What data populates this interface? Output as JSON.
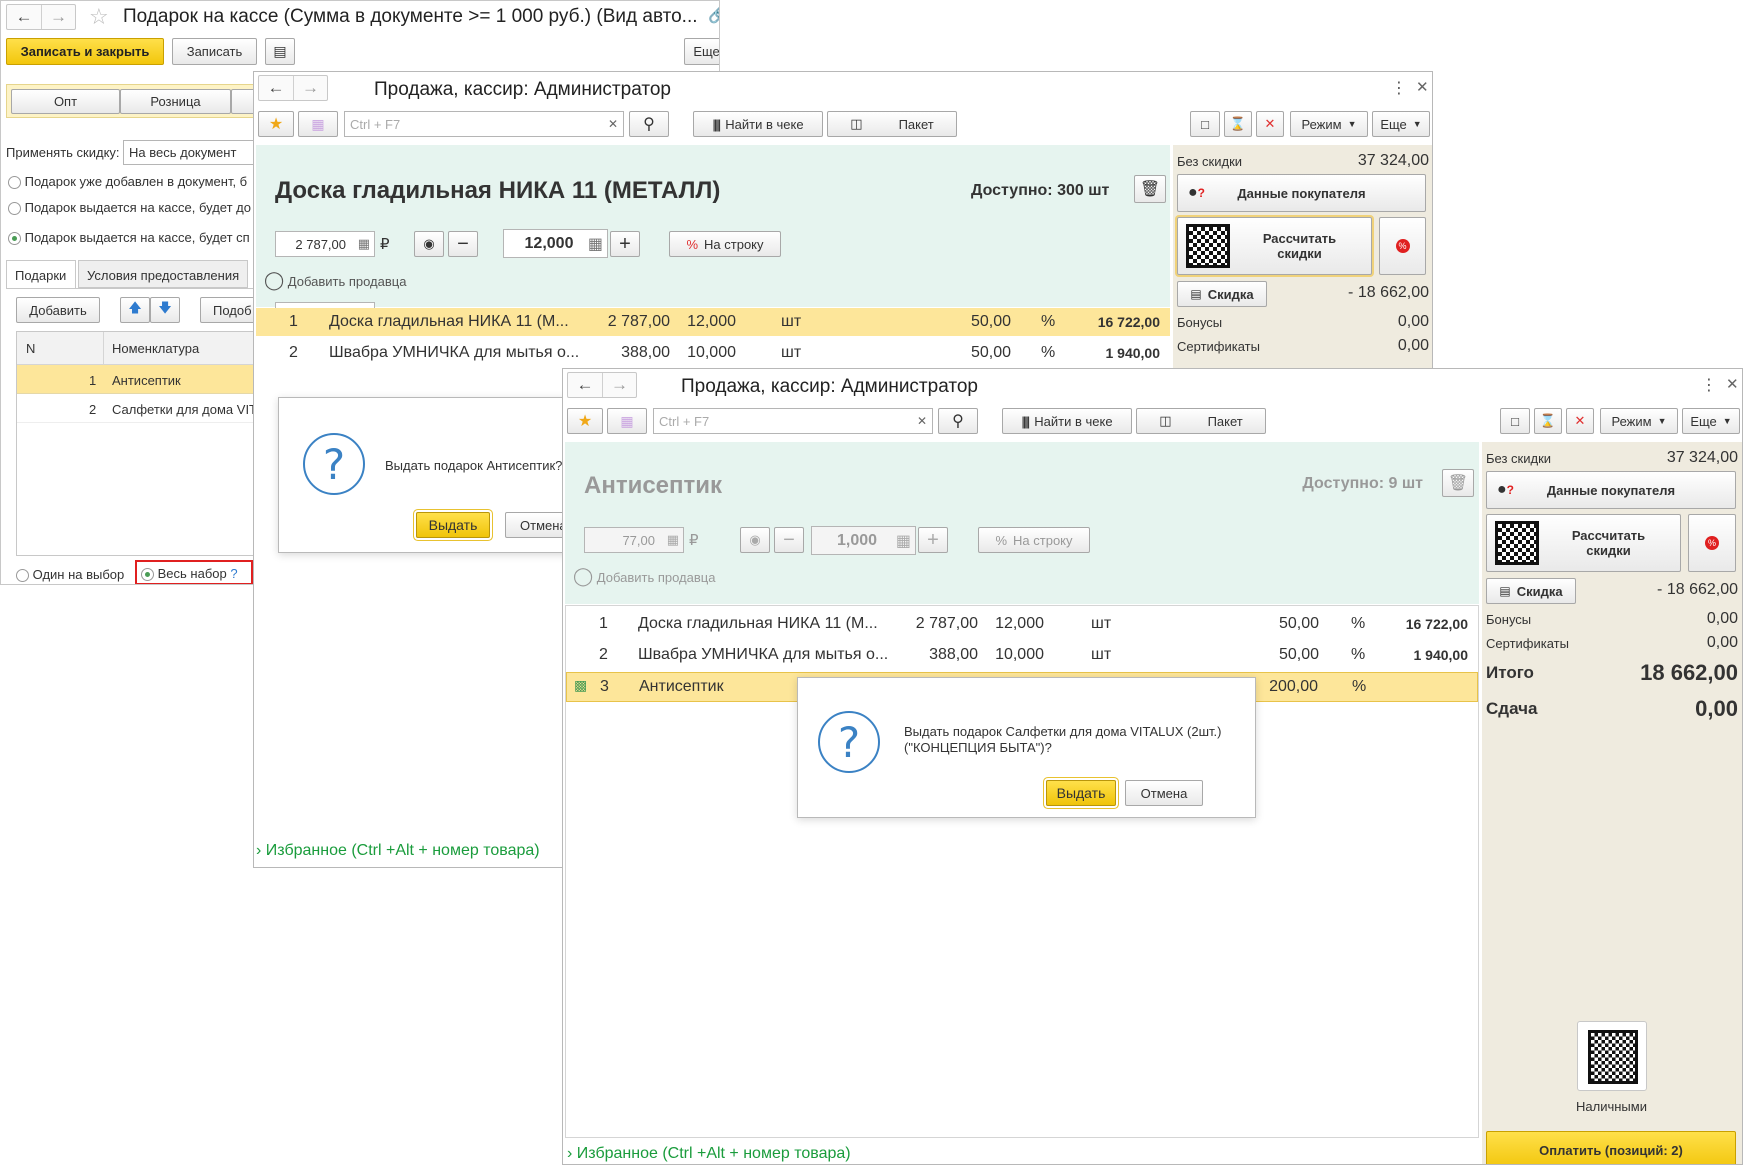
{
  "w1": {
    "title": "Подарок на кассе (Сумма в документе >= 1 000 руб.) (Вид авто...",
    "save_close": "Записать и закрыть",
    "save": "Записать",
    "more": "Еще",
    "help": "?",
    "tabs_top": [
      "Опт",
      "Розница"
    ],
    "apply_label": "Применять скидку:",
    "apply_value": "На весь документ",
    "radios": [
      "Подарок уже добавлен в документ, б",
      "Подарок выдается на кассе, будет до",
      "Подарок выдается на кассе, будет сп"
    ],
    "tab_gifts": "Подарки",
    "tab_conditions": "Условия предоставления",
    "add": "Добавить",
    "pick": "Подоб",
    "col_n": "N",
    "col_nom": "Номенклатура",
    "rows": [
      {
        "n": "1",
        "name": "Антисептик"
      },
      {
        "n": "2",
        "name": "Салфетки для дома VIT"
      }
    ],
    "one_choice": "Один на выбор",
    "whole_set": "Весь набор",
    "whole_help": "?"
  },
  "w2": {
    "title": "Продажа, кассир: Администратор",
    "search_placeholder": "Ctrl + F7",
    "find": "Найти в чеке",
    "package": "Пакет",
    "mode": "Режим",
    "more": "Еще",
    "product": "Доска гладильная  НИКА 11 (МЕТАЛЛ)",
    "available": "Доступно: 300 шт",
    "price": "2 787,00",
    "currency": "₽",
    "qty": "12,000",
    "per_line": "На строку",
    "add_seller": "Добавить продавца",
    "lines": [
      {
        "n": "1",
        "name": "Доска гладильная  НИКА 11 (М...",
        "price": "2 787,00",
        "qty": "12,000",
        "unit": "шт",
        "disc": "50,00",
        "pct": "%",
        "sum": "16 722,00"
      },
      {
        "n": "2",
        "name": "Швабра УМНИЧКА для мытья о...",
        "price": "388,00",
        "qty": "10,000",
        "unit": "шт",
        "disc": "50,00",
        "pct": "%",
        "sum": "1 940,00"
      }
    ],
    "no_discount_label": "Без скидки",
    "no_discount_value": "37 324,00",
    "buyer_data": "Данные покупателя",
    "calc_discount": "Рассчитать скидки",
    "discount": "Скидка",
    "discount_value": "- 18 662,00",
    "bonuses": "Бонусы",
    "bonuses_value": "0,00",
    "certificates": "Сертификаты",
    "certificates_value": "0,00",
    "dialog_text": "Выдать подарок Антисептик?",
    "dialog_ok": "Выдать",
    "dialog_cancel": "Отмена",
    "favorites": "Избранное (Ctrl +Alt + номер товара)"
  },
  "w3": {
    "title": "Продажа, кассир: Администратор",
    "search_placeholder": "Ctrl + F7",
    "find": "Найти в чеке",
    "package": "Пакет",
    "mode": "Режим",
    "more": "Еще",
    "product": "Антисептик",
    "available": "Доступно: 9 шт",
    "price": "77,00",
    "currency": "₽",
    "qty": "1,000",
    "per_line": "На строку",
    "add_seller": "Добавить продавца",
    "lines": [
      {
        "n": "1",
        "name": "Доска гладильная  НИКА 11 (М...",
        "price": "2 787,00",
        "qty": "12,000",
        "unit": "шт",
        "disc": "50,00",
        "pct": "%",
        "sum": "16 722,00"
      },
      {
        "n": "2",
        "name": "Швабра УМНИЧКА для мытья о...",
        "price": "388,00",
        "qty": "10,000",
        "unit": "шт",
        "disc": "50,00",
        "pct": "%",
        "sum": "1 940,00"
      },
      {
        "n": "3",
        "name": "Антисептик",
        "price": "",
        "qty": "",
        "unit": "",
        "disc": "200,00",
        "pct": "%",
        "sum": ""
      }
    ],
    "no_discount_label": "Без скидки",
    "no_discount_value": "37 324,00",
    "buyer_data": "Данные покупателя",
    "calc_discount": "Рассчитать скидки",
    "discount": "Скидка",
    "discount_value": "- 18 662,00",
    "bonuses": "Бонусы",
    "bonuses_value": "0,00",
    "certificates": "Сертификаты",
    "certificates_value": "0,00",
    "total_label": "Итого",
    "total_value": "18 662,00",
    "change_label": "Сдача",
    "change_value": "0,00",
    "cash": "Наличными",
    "pay": "Оплатить (позиций: 2)",
    "dialog_text": "Выдать подарок Салфетки для дома VITALUX (2шт.) (\"КОНЦЕПЦИЯ БЫТА\")?",
    "dialog_ok": "Выдать",
    "dialog_cancel": "Отмена",
    "favorites": "Избранное (Ctrl +Alt + номер товара)"
  },
  "colors": {
    "accent_yellow": "#f5c91a",
    "selected_row": "#fde69a",
    "green_area": "#e6f4ef",
    "right_panel": "#efebdf",
    "favorites": "#1a9c3c",
    "highlight_red": "#e02020"
  }
}
